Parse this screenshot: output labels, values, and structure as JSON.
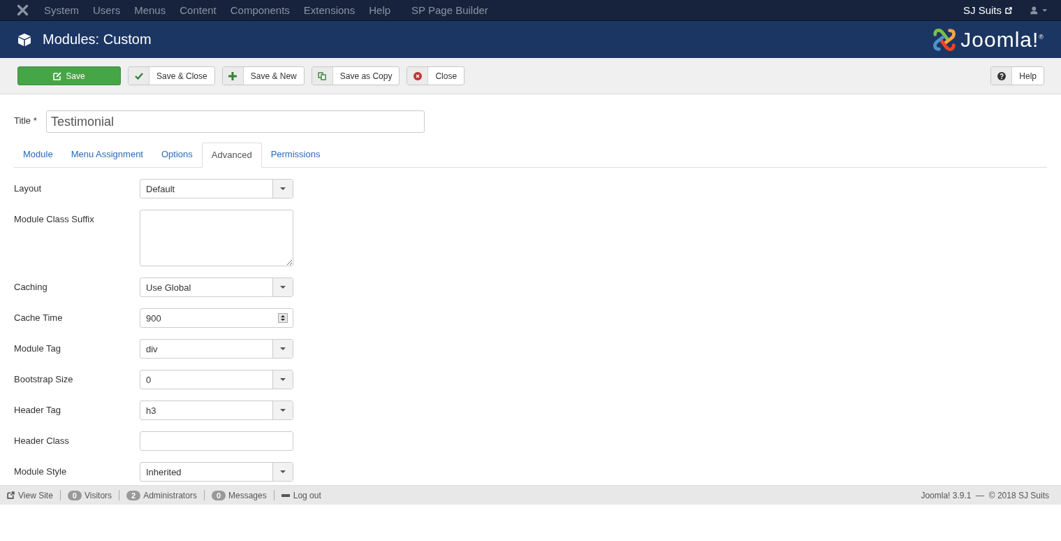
{
  "menu_bar": {
    "items": [
      "System",
      "Users",
      "Menus",
      "Content",
      "Components",
      "Extensions",
      "Help",
      "SP Page Builder"
    ],
    "site_link": "SJ Suits"
  },
  "header": {
    "title": "Modules: Custom",
    "brand": "Joomla!$^{®}$"
  },
  "toolbar": {
    "buttons": [
      {
        "kind": "primary",
        "label": "Save"
      },
      {
        "kind": "check",
        "label": "Save & Close"
      },
      {
        "kind": "plus",
        "label": "Save & New"
      },
      {
        "kind": "copy",
        "label": "Save as Copy"
      },
      {
        "kind": "close",
        "label": "Close"
      }
    ],
    "help": "Help"
  },
  "title_field": {
    "label": "Title *",
    "value": "Testimonial"
  },
  "tabs": [
    {
      "label": "Module",
      "selected": false
    },
    {
      "label": "Menu Assignment",
      "selected": false
    },
    {
      "label": "Options",
      "selected": false
    },
    {
      "label": "Advanced",
      "selected": true
    },
    {
      "label": "Permissions",
      "selected": false
    }
  ],
  "fields": [
    {
      "kind": "select",
      "label": "Layout",
      "value": "Default"
    },
    {
      "kind": "textarea",
      "label": "Module Class Suffix"
    },
    {
      "kind": "select",
      "label": "Caching",
      "value": "Use Global"
    },
    {
      "kind": "number",
      "label": "Cache Time",
      "value": "900"
    },
    {
      "kind": "select",
      "label": "Module Tag",
      "value": "div"
    },
    {
      "kind": "select",
      "label": "Bootstrap Size",
      "value": "0"
    },
    {
      "kind": "select",
      "label": "Header Tag",
      "value": "h3"
    },
    {
      "kind": "text",
      "label": "Header Class"
    },
    {
      "kind": "select",
      "label": "Module Style",
      "value": "Inherited"
    }
  ],
  "status_bar": {
    "view_site": "View Site",
    "counters": [
      {
        "count": "0",
        "label": "Visitors"
      },
      {
        "count": "2",
        "label": "Administrators"
      },
      {
        "count": "0",
        "label": "Messages"
      }
    ],
    "logout": "Log out",
    "version": "Joomla! 3.9.1  —  © 2018 SJ Suits"
  }
}
